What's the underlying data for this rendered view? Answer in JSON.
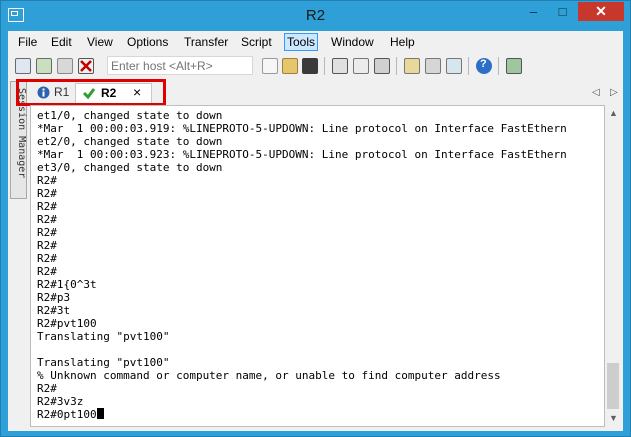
{
  "window": {
    "title": "R2",
    "close_glyph": "✕",
    "min_glyph": "–",
    "max_glyph": "□"
  },
  "menu": [
    "File",
    "Edit",
    "View",
    "Options",
    "Transfer",
    "Script",
    "Tools",
    "Window",
    "Help"
  ],
  "toolbar": {
    "host_placeholder": "Enter host <Alt+R>"
  },
  "session_manager": {
    "label": "Session Manager"
  },
  "tabs": [
    {
      "label": "R1",
      "status_icon": "info-icon"
    },
    {
      "label": "R2",
      "status_icon": "check-icon",
      "close_glyph": "×"
    }
  ],
  "terminal": {
    "lines": [
      "et1/0, changed state to down",
      "*Mar  1 00:00:03.919: %LINEPROTO-5-UPDOWN: Line protocol on Interface FastEthern",
      "et2/0, changed state to down",
      "*Mar  1 00:00:03.923: %LINEPROTO-5-UPDOWN: Line protocol on Interface FastEthern",
      "et3/0, changed state to down",
      "R2#",
      "R2#",
      "R2#",
      "R2#",
      "R2#",
      "R2#",
      "R2#",
      "R2#",
      "R2#1{0^3t",
      "R2#p3",
      "R2#3t",
      "R2#pvt100",
      "Translating \"pvt100\"",
      "",
      "Translating \"pvt100\"",
      "% Unknown command or computer name, or unable to find computer address",
      "R2#",
      "R2#3v3z"
    ],
    "last_line": "R2#0pt100"
  },
  "colors": {
    "titlebar": "#2f9fd7",
    "close_button": "#c7372c",
    "highlight_box": "#e00000"
  }
}
